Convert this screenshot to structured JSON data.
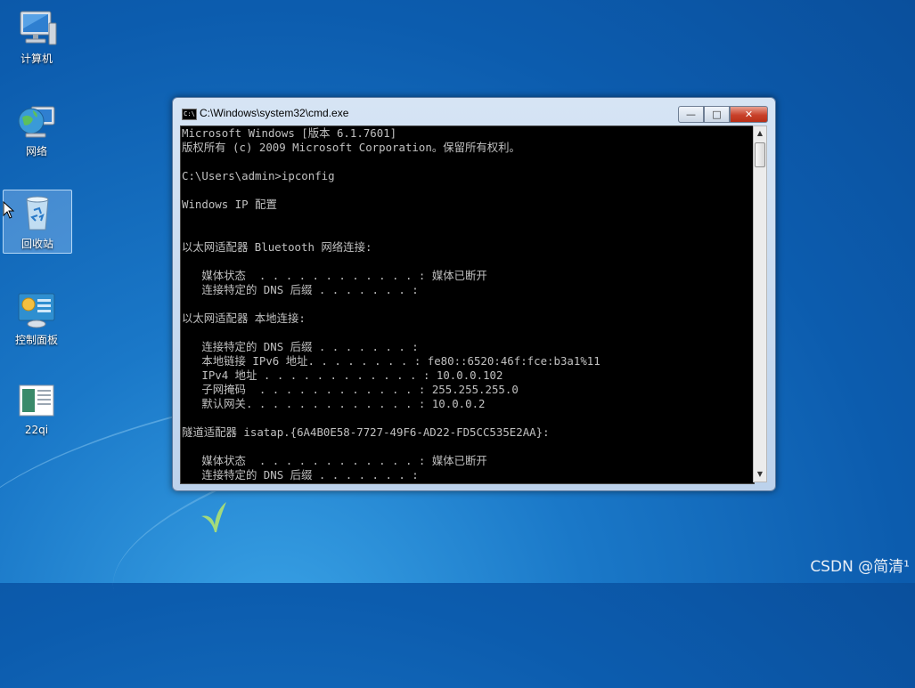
{
  "desktop": {
    "icons": [
      {
        "label": "计算机"
      },
      {
        "label": "网络"
      },
      {
        "label": "回收站"
      },
      {
        "label": "控制面板"
      },
      {
        "label": "22qi"
      }
    ]
  },
  "window": {
    "title": "C:\\Windows\\system32\\cmd.exe",
    "controls": {
      "minimize": "—",
      "maximize": "□",
      "close": "✕"
    },
    "console_lines": [
      "Microsoft Windows [版本 6.1.7601]",
      "版权所有 (c) 2009 Microsoft Corporation。保留所有权利。",
      "",
      "C:\\Users\\admin>ipconfig",
      "",
      "Windows IP 配置",
      "",
      "",
      "以太网适配器 Bluetooth 网络连接:",
      "",
      "   媒体状态  . . . . . . . . . . . . : 媒体已断开",
      "   连接特定的 DNS 后缀 . . . . . . . :",
      "",
      "以太网适配器 本地连接:",
      "",
      "   连接特定的 DNS 后缀 . . . . . . . :",
      "   本地链接 IPv6 地址. . . . . . . . : fe80::6520:46f:fce:b3a1%11",
      "   IPv4 地址 . . . . . . . . . . . . : 10.0.0.102",
      "   子网掩码  . . . . . . . . . . . . : 255.255.255.0",
      "   默认网关. . . . . . . . . . . . . : 10.0.0.2",
      "",
      "隧道适配器 isatap.{6A4B0E58-7727-49F6-AD22-FD5CC535E2AA}:",
      "",
      "   媒体状态  . . . . . . . . . . . . : 媒体已断开",
      "   连接特定的 DNS 后缀 . . . . . . . :"
    ]
  },
  "watermark": "CSDN @简清¹",
  "colors": {
    "console_bg": "#000000",
    "console_text": "#c0c0c0",
    "desktop": "#1a78c8"
  }
}
